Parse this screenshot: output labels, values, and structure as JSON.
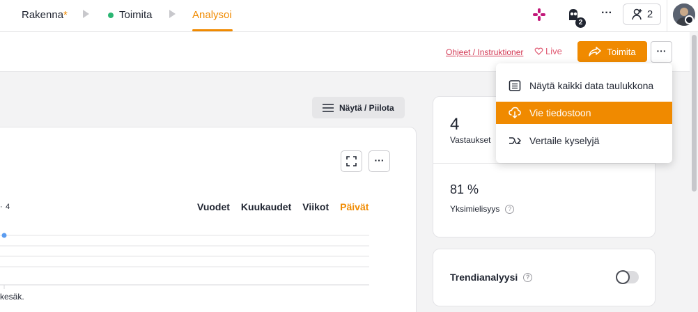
{
  "nav": {
    "steps": [
      {
        "label": "Rakenna",
        "marker": "*"
      },
      {
        "label": "Toimita"
      },
      {
        "label": "Analysoi"
      }
    ],
    "bot_badge": "2",
    "more": "···",
    "collaborators_count": "2"
  },
  "toolbar": {
    "help_link": "Ohjeet / Instruktioner",
    "live": "Live",
    "publish_label": "Toimita",
    "more": "···"
  },
  "dropdown": {
    "items": [
      {
        "label": "Näytä kaikki data taulukkona",
        "icon": "table-icon"
      },
      {
        "label": "Vie tiedostoon",
        "icon": "cloud-download-icon"
      },
      {
        "label": "Vertaile kyselyjä",
        "icon": "compare-arrow-icon"
      }
    ]
  },
  "main": {
    "show_hide_label": "Näytä / Piilota",
    "chart_more": "···",
    "legend_value": "4",
    "period_tabs": [
      "Vuodet",
      "Kuukaudet",
      "Viikot",
      "Päivät"
    ],
    "active_period": "Päivät",
    "x_axis_label": "kesäk."
  },
  "stats": {
    "responses_value": "4",
    "responses_label": "Vastaukset",
    "agreement_value": "81 %",
    "agreement_label": "Yksimielisyys",
    "trend_label": "Trendianalyysi",
    "trend_enabled": false
  },
  "colors": {
    "accent": "#f08a00",
    "live": "#e05a72",
    "link": "#d33a55",
    "status_green": "#2bb673"
  }
}
